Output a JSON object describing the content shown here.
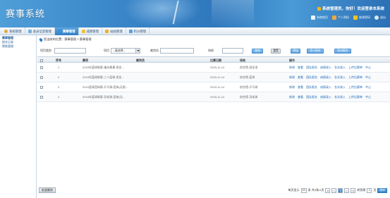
{
  "header": {
    "title": "赛事系统",
    "welcome": "系统管理员，你好！欢迎登录本系统",
    "links": [
      {
        "label": "系统首页",
        "icon": "home-icon"
      },
      {
        "label": "个人资料",
        "icon": "user-icon"
      },
      {
        "label": "修改密码",
        "icon": "lock-icon"
      },
      {
        "label": "退出",
        "icon": "exit-icon"
      }
    ]
  },
  "nav": {
    "tabs": [
      {
        "label": "系统管理",
        "icon": "gear-icon"
      },
      {
        "label": "会员信息管理",
        "icon": "member-icon"
      },
      {
        "label": "赛事管理",
        "icon": "event-icon",
        "active": true
      },
      {
        "label": "成绩管理",
        "icon": "score-icon"
      },
      {
        "label": "站站管理",
        "icon": "folder-icon"
      },
      {
        "label": "积分管理",
        "icon": "chart-icon"
      }
    ]
  },
  "sidebar": {
    "items": [
      {
        "label": "赛事管理",
        "active": true
      },
      {
        "label": "报名记录"
      },
      {
        "label": "赞助管理"
      }
    ]
  },
  "breadcrumb": "您当前的位置：赛事管理 > 赛事管理",
  "filter": {
    "category_label": "项目类别",
    "category_value": "",
    "project_label": "项目",
    "project_value": "--请选择--",
    "referee_label": "裁判员",
    "referee_value": "",
    "venue_label": "场地",
    "venue_value": "",
    "buttons": [
      "查询",
      "重置",
      "添加",
      "导入报名",
      "导出报名"
    ]
  },
  "table": {
    "headers": [
      "序号",
      "赛项",
      "裁判员",
      "比赛日期",
      "场地",
      "操作"
    ],
    "rows": [
      {
        "no": "1",
        "event": "2015年篮球联赛-福州黄事-男女...",
        "referee": "",
        "date": "2015-11-14",
        "venue": "综合馆-游泳池"
      },
      {
        "no": "2",
        "event": "2015年篮球联赛-三人篮球-男女...",
        "referee": "",
        "date": "2015-11-14",
        "venue": "综合馆-篮球"
      },
      {
        "no": "3",
        "event": "2015篮球团体赛-乒乓球-团体(无限...",
        "referee": "",
        "date": "2015-11-14",
        "venue": "综合馆-乒乓球"
      },
      {
        "no": "4",
        "event": "2015年篮球联赛-羽毛球-团体(无...",
        "referee": "",
        "date": "2015-11-14",
        "venue": "综合馆-羽毛球"
      }
    ],
    "ops": [
      "修改",
      "查看",
      "团队报名",
      "成绩录入",
      "名次录入",
      "上传比赛单",
      "中止"
    ]
  },
  "footer": {
    "batch_delete": "批量删除",
    "page_size_label": "每页显示",
    "page_size": "10",
    "records_text": "条  共4条/1页",
    "current_page": "1",
    "goto_label": "转到第",
    "goto_value": "1",
    "page_suffix": "页",
    "go_label": "跳转"
  }
}
